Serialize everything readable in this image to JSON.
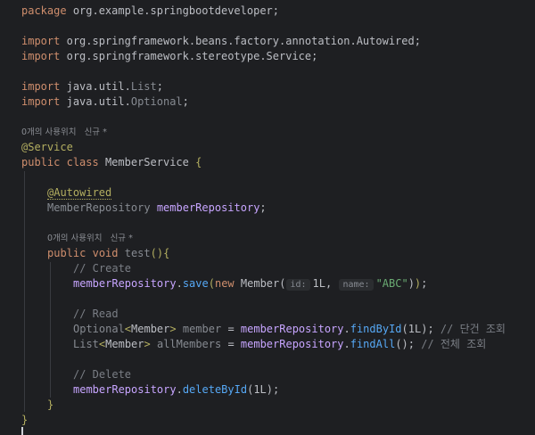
{
  "code": {
    "package_kw": "package",
    "package_name": "org.example.springbootdeveloper;",
    "import_kw": "import",
    "import1": "org.springframework.beans.factory.annotation.Autowired;",
    "import2": "org.springframework.stereotype.Service;",
    "import3_pkg": "java.util.",
    "import3_cls": "List",
    "import4_pkg": "java.util.",
    "import4_cls": "Optional",
    "semicolon": ";",
    "usage_hint_class": "0개의 사용위치   신규 *",
    "service_ann": "@Service",
    "public_kw": "public",
    "class_kw": "class",
    "class_name": "MemberService",
    "open_brace": "{",
    "autowired_ann": "@Autowired",
    "repo_type": "MemberRepository",
    "repo_field": "memberRepository",
    "usage_hint_method": "0개의 사용위치   신규 *",
    "void_kw": "void",
    "method_name": "test",
    "method_sig_tail": "(){",
    "cmt_create": "// Create",
    "save_call": "save",
    "new_kw": "new",
    "member_cls": "Member",
    "hint_id": "id:",
    "arg_1l": "1L",
    "hint_name": "name:",
    "arg_abc": "\"ABC\"",
    "cmt_read": "// Read",
    "optional_type": "Optional",
    "member_generic": "Member",
    "var_member": "member",
    "find_by_id": "findById",
    "cmt_single": "// 단건 조회",
    "list_type": "List",
    "var_all": "allMembers",
    "find_all": "findAll",
    "cmt_all": "// 전체 조회",
    "cmt_delete": "// Delete",
    "delete_by_id": "deleteById",
    "close_brace": "}"
  },
  "colors": {
    "background": "#1e1f22",
    "keyword": "#cf8e6d",
    "annotation": "#b3ae60",
    "method": "#56a8f5",
    "string": "#6aab73",
    "number": "#2aacb8",
    "comment": "#7a7e85"
  }
}
